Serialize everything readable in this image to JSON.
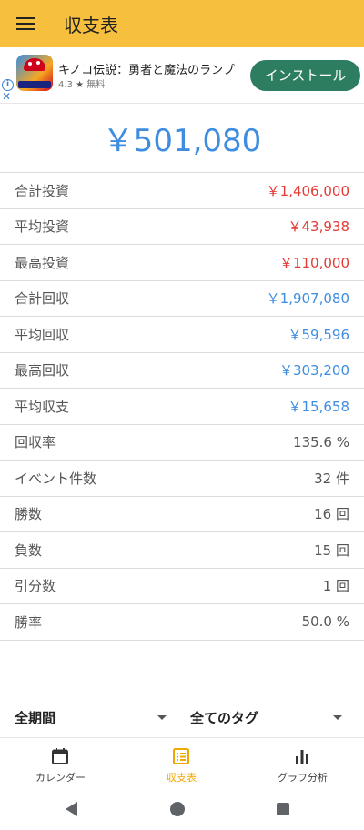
{
  "appbar": {
    "title": "収支表"
  },
  "ad": {
    "title": "キノコ伝説：勇者と魔法のランプ",
    "rating": "4.3",
    "star": "★",
    "price": "無料",
    "install_label": "インストール",
    "info_icon": "info-icon",
    "close_icon": "close-icon"
  },
  "summary": {
    "total": "￥501,080"
  },
  "stats": [
    {
      "label": "合計投資",
      "value": "￥1,406,000",
      "color": "#e53935"
    },
    {
      "label": "平均投資",
      "value": "￥43,938",
      "color": "#e53935"
    },
    {
      "label": "最高投資",
      "value": "￥110,000",
      "color": "#e53935"
    },
    {
      "label": "合計回収",
      "value": "￥1,907,080",
      "color": "#3e8de0"
    },
    {
      "label": "平均回収",
      "value": "￥59,596",
      "color": "#3e8de0"
    },
    {
      "label": "最高回収",
      "value": "￥303,200",
      "color": "#3e8de0"
    },
    {
      "label": "平均収支",
      "value": "￥15,658",
      "color": "#3e8de0"
    },
    {
      "label": "回収率",
      "value": "135.6 %",
      "color": "#555555"
    },
    {
      "label": "イベント件数",
      "value": "32 件",
      "color": "#555555"
    },
    {
      "label": "勝数",
      "value": "16 回",
      "color": "#555555"
    },
    {
      "label": "負数",
      "value": "15 回",
      "color": "#555555"
    },
    {
      "label": "引分数",
      "value": "1 回",
      "color": "#555555"
    },
    {
      "label": "勝率",
      "value": "50.0 %",
      "color": "#555555"
    }
  ],
  "filters": {
    "period": "全期間",
    "tags": "全てのタグ"
  },
  "bottom_nav": [
    {
      "label": "カレンダー",
      "icon": "calendar-icon"
    },
    {
      "label": "収支表",
      "icon": "list-icon",
      "active": true
    },
    {
      "label": "グラフ分析",
      "icon": "bar-chart-icon"
    }
  ],
  "colors": {
    "appbar": "#f7bf3e",
    "accent_blue": "#3e8de0",
    "accent_red": "#e53935",
    "install": "#2d7d61",
    "active_nav": "#f0a800"
  }
}
